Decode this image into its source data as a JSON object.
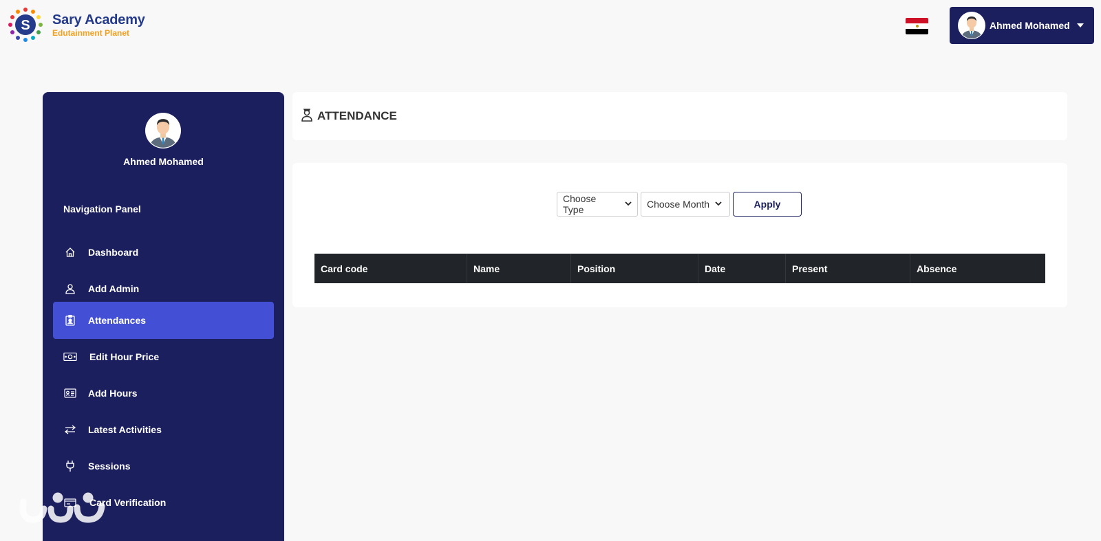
{
  "brand": {
    "name": "Sary Academy",
    "tagline": "Edutainment Planet",
    "logo_letter": "S"
  },
  "header": {
    "user_name": "Ahmed Mohamed",
    "flag_icon": "egypt-flag-icon"
  },
  "sidebar": {
    "user_name": "Ahmed Mohamed",
    "heading": "Navigation Panel",
    "items": [
      {
        "label": "Dashboard",
        "icon": "home-icon",
        "active": false
      },
      {
        "label": "Add Admin",
        "icon": "user-icon",
        "active": false
      },
      {
        "label": "Attendances",
        "icon": "id-badge-icon",
        "active": true
      },
      {
        "label": "Edit Hour Price",
        "icon": "cash-icon",
        "active": false
      },
      {
        "label": "Add Hours",
        "icon": "id-card-icon",
        "active": false
      },
      {
        "label": "Latest Activities",
        "icon": "arrows-exchange-icon",
        "active": false
      },
      {
        "label": "Sessions",
        "icon": "plug-icon",
        "active": false
      },
      {
        "label": "Card Verification",
        "icon": "card-check-icon",
        "active": false
      }
    ]
  },
  "page": {
    "title": "ATTENDANCE",
    "title_icon": "user-clock-icon"
  },
  "filters": {
    "type_select": "Choose Type",
    "month_select": "Choose Month",
    "apply_label": "Apply"
  },
  "table": {
    "columns": [
      "Card code",
      "Name",
      "Position",
      "Date",
      "Present",
      "Absence"
    ],
    "rows": []
  },
  "colors": {
    "sidebar_bg": "#1c1f5e",
    "active_item": "#434fd4",
    "table_header": "#212529",
    "brand_blue": "#243a8a",
    "brand_orange": "#f3a01e"
  }
}
